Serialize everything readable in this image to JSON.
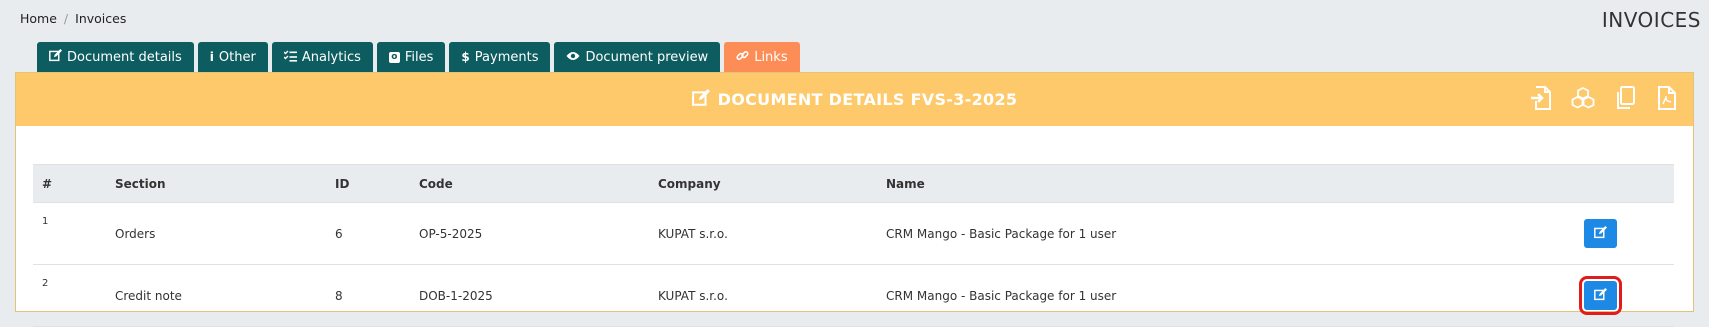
{
  "breadcrumb": {
    "home": "Home",
    "current": "Invoices"
  },
  "page_title": "INVOICES",
  "tabs": [
    {
      "label": "Document details",
      "icon": "edit-icon"
    },
    {
      "label": "Other",
      "icon": "info-icon"
    },
    {
      "label": "Analytics",
      "icon": "list-check-icon"
    },
    {
      "label": "Files",
      "icon": "file-icon"
    },
    {
      "label": "Payments",
      "icon": "dollar-icon"
    },
    {
      "label": "Document preview",
      "icon": "eye-icon"
    },
    {
      "label": "Links",
      "icon": "link-icon",
      "active": true
    }
  ],
  "panel": {
    "title": "DOCUMENT DETAILS FVS-3-2025",
    "header_actions": [
      "import-icon",
      "cubes-icon",
      "copy-icon",
      "pdf-icon"
    ]
  },
  "table": {
    "headers": [
      "#",
      "Section",
      "ID",
      "Code",
      "Company",
      "Name"
    ],
    "rows": [
      {
        "num": "1",
        "section": "Orders",
        "id": "6",
        "code": "OP-5-2025",
        "company": "KUPAT s.r.o.",
        "name": "CRM Mango - Basic Package for 1 user"
      },
      {
        "num": "2",
        "section": "Credit note",
        "id": "8",
        "code": "DOB-1-2025",
        "company": "KUPAT s.r.o.",
        "name": "CRM Mango - Basic Package for 1 user"
      }
    ]
  },
  "colors": {
    "tab": "#0d5c5f",
    "tab_active": "#fd8d57",
    "panel_header": "#fec96b",
    "edit_button": "#1e88e5",
    "highlight": "#e21b1b"
  }
}
